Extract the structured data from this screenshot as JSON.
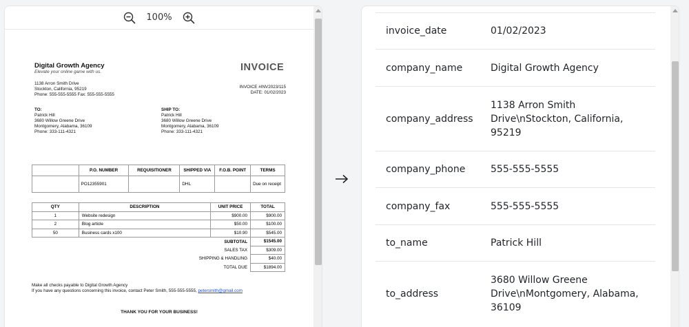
{
  "toolbar": {
    "zoom_level": "100%",
    "zoom_out_icon": "zoom-out-icon",
    "zoom_in_icon": "zoom-in-icon"
  },
  "invoice": {
    "company_name": "Digital Growth Agency",
    "tagline": "Elevate your online game with us.",
    "address_line1": "1138 Arron Smith Drive",
    "address_line2": "Stockton, California, 95219",
    "phone_fax": "Phone: 555-555-5555 Fax: 555-555-5555",
    "title": "INVOICE",
    "number": "INVOICE #INV2023/115",
    "date": "DATE: 01/02/2023",
    "to_label": "TO:",
    "to_name": "Patrick Hill",
    "to_addr1": "3680 Willow Greene Drive",
    "to_addr2": "Montgomery, Alabama, 36109",
    "to_phone": "Phone: 333-111-4321",
    "ship_label": "SHIP TO:",
    "ship_name": "Patrick Hill",
    "ship_addr1": "3680 Willow Greene Drive",
    "ship_addr2": "Montgomery, Alabama, 36109",
    "ship_phone": "Phone: 333-111-4321",
    "po_headers": [
      "",
      "P.O. NUMBER",
      "REQUISITIONER",
      "SHIPPED VIA",
      "F.O.B. POINT",
      "TERMS"
    ],
    "po_values": [
      "",
      "PO12355901",
      "",
      "DHL",
      "",
      "Due on receipt"
    ],
    "item_headers": [
      "QTY",
      "DESCRIPTION",
      "UNIT PRICE",
      "TOTAL"
    ],
    "items": [
      {
        "qty": "1",
        "desc": "Website redesign",
        "unit": "$900.00",
        "total": "$900.00"
      },
      {
        "qty": "2",
        "desc": "Blog article",
        "unit": "$50.00",
        "total": "$100.00"
      },
      {
        "qty": "50",
        "desc": "Business cards x100",
        "unit": "$10.90",
        "total": "$545.00"
      }
    ],
    "subtotal_label": "SUBTOTAL",
    "subtotal": "$1545.00",
    "tax_label": "SALES TAX",
    "tax": "$309.00",
    "shipping_label": "SHIPPING & HANDLING",
    "shipping": "$40.00",
    "total_label": "TOTAL DUE",
    "total": "$1894.00",
    "footer_line1": "Make all checks payable to Digital Growth Agency",
    "footer_line2": "If you have any questions concerning this invoice, contact Peter Smith, 555-555-5555,",
    "footer_email": "petersmith@gmail.com",
    "thanks": "THANK YOU FOR YOUR BUSINESS!"
  },
  "fields": [
    {
      "key": "invoice_date",
      "value": "01/02/2023"
    },
    {
      "key": "company_name",
      "value": "Digital Growth Agency"
    },
    {
      "key": "company_address",
      "value": "1138 Arron Smith Drive\\nStockton, California, 95219"
    },
    {
      "key": "company_phone",
      "value": "555-555-5555"
    },
    {
      "key": "company_fax",
      "value": "555-555-5555"
    },
    {
      "key": "to_name",
      "value": "Patrick Hill"
    },
    {
      "key": "to_address",
      "value": "3680 Willow Greene Drive\\nMontgomery, Alabama, 36109"
    }
  ],
  "colors": {
    "link": "#1a4fd8",
    "border": "#e3e5e8",
    "scroll_thumb": "#c1c1c1"
  }
}
